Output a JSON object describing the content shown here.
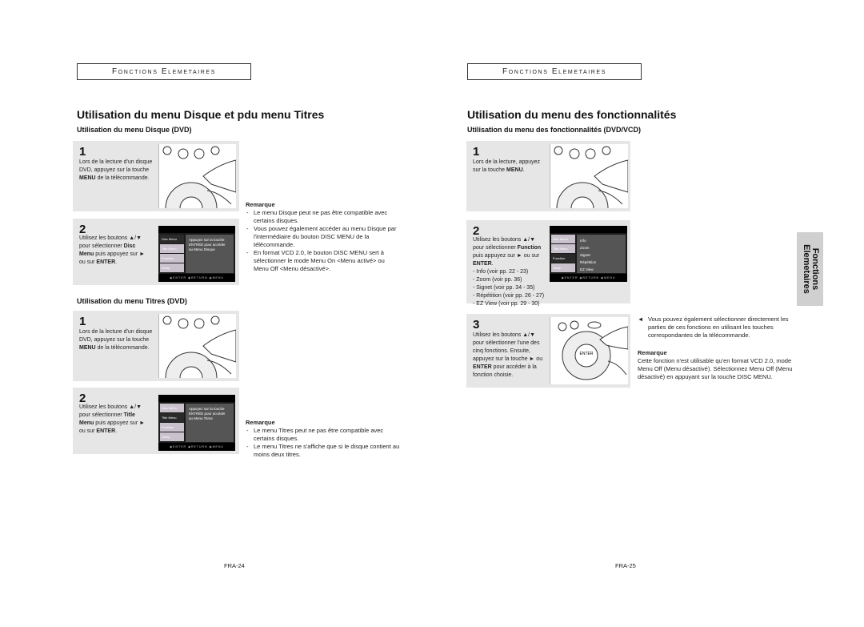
{
  "left_page": {
    "section_header": "Fonctions Elemetaires",
    "title": "Utilisation du menu Disque et pdu menu Titres",
    "disc_menu": {
      "subtitle": "Utilisation du menu Disque (DVD)",
      "step1": {
        "num": "1",
        "text_pre": "Lors de la lecture d'un disque DVD, appuyez sur la touche ",
        "text_bold": "MENU",
        "text_post": " de la télécommande."
      },
      "step2": {
        "num": "2",
        "line1": "Utilisez les boutons ▲/▼",
        "line2_pre": "pour sélectionner ",
        "line2_bold": "Disc",
        "line3_bold": "Menu",
        "line3_post": " puis appuyez sur ►",
        "line4_pre": "ou sur ",
        "line4_bold": "ENTER",
        "line4_post": "."
      },
      "osd": {
        "items": [
          "Disc Menu",
          "Title Menu",
          "Function",
          "Setup"
        ],
        "selected": 0,
        "message": "Appuyez sur la touche ENTRÉE pour accéder au Menu Disque",
        "footer": "◉ENTER ◉RETURN ◉MENU"
      },
      "remark": {
        "title": "Remarque",
        "items": [
          "Le menu Disque peut ne pas être compatible avec certains disques.",
          "Vous pouvez également accéder au menu Disque par l'intermédiaire du bouton DISC MENU de la télécommande.",
          "En format VCD 2.0, le bouton DISC MENU sert à sélectionner le mode Menu On <Menu activé> ou Menu Off <Menu désactivé>."
        ]
      }
    },
    "title_menu": {
      "subtitle": "Utilisation du menu Titres (DVD)",
      "step1": {
        "num": "1",
        "text_pre": "Lors de la lecture d'un disque DVD, appuyez sur la touche ",
        "text_bold": "MENU",
        "text_post": " de la télécommande."
      },
      "step2": {
        "num": "2",
        "line1": "Utilisez les boutons ▲/▼",
        "line2_pre": "pour sélectionner ",
        "line2_bold": "Title",
        "line3_bold": "Menu",
        "line3_post": " puis appuyez sur ►",
        "line4_pre": "ou sur ",
        "line4_bold": "ENTER",
        "line4_post": "."
      },
      "osd": {
        "items": [
          "Disc Menu",
          "Title Menu",
          "Function",
          "Setup"
        ],
        "selected": 1,
        "message": "Appuyez sur la touche ENTRÉE pour accéder au Menu Titres",
        "footer": "◉ENTER ◉RETURN ◉MENU"
      },
      "remark": {
        "title": "Remarque",
        "items": [
          "Le menu Titres peut ne pas être compatible avec certains disques.",
          "Le menu Titres ne s'affiche que si le disque contient au moins deux titres."
        ]
      }
    },
    "page_number": "FRA-24"
  },
  "right_page": {
    "section_header": "Fonctions Elemetaires",
    "title": "Utilisation du menu des fonctionnalités",
    "subtitle": "Utilisation du menu des fonctionnalités (DVD/VCD)",
    "step1": {
      "num": "1",
      "text_pre": "Lors de la lecture, appuyez sur la touche ",
      "text_bold": "MENU",
      "text_post": "."
    },
    "step2": {
      "num": "2",
      "line1": "Utilisez les boutons ▲/▼",
      "line2_pre": "pour sélectionner ",
      "line2_bold": "Function",
      "line3": "puis appuyez sur ► ou sur",
      "line4_bold": "ENTER",
      "line4_post": ".",
      "functions": [
        "Info (voir pp. 22 - 23)",
        "Zoom (voir pp. 36)",
        "Signet (voir pp. 34 - 35)",
        "Répétition (voir pp. 26 - 27)",
        "EZ View (voir pp. 29 - 30)"
      ]
    },
    "osd": {
      "items": [
        "Disc Menu",
        "Title Menu",
        "Function",
        "Setup"
      ],
      "selected": 2,
      "options": [
        "Info",
        "Zoom",
        "Signet",
        "Répétition",
        "EZ View"
      ],
      "footer": "◉ENTER ◉RETURN ◉MENU"
    },
    "step3": {
      "num": "3",
      "line1": "Utilisez les boutons ▲/▼",
      "line2": "pour sélectionner l'une des",
      "line3": "cinq fonctions. Ensuite,",
      "line4": "appuyez sur la touche ► ou",
      "line5_bold": "ENTER",
      "line5_post": " pour accéder à la",
      "line6": "fonction choisie."
    },
    "tip": {
      "icon": "◄",
      "text": "Vous pouvez également sélectionner directement les parties de ces fonctions en utilisant les touches correspondantes de la télécommande."
    },
    "remark": {
      "title": "Remarque",
      "text": "Cette fonction n'est utilisable qu'en format VCD 2.0, mode Menu Off (Menu désactivé). Sélectionnez Menu Off (Menu désactivé) en appuyant sur la touche DISC MENU."
    },
    "side_tab": {
      "line1": "Fonctions",
      "line2": "Elemetaires"
    },
    "page_number": "FRA-25"
  }
}
